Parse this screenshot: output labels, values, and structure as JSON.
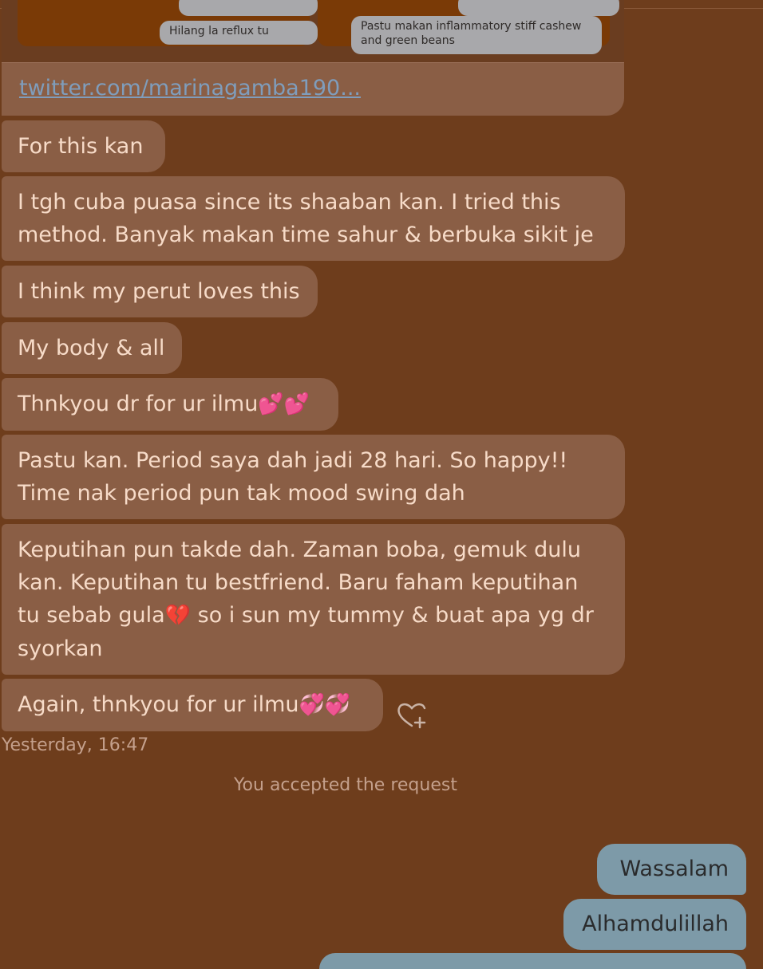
{
  "tweet_preview": {
    "media_left_text": "Hilang la reflux tu",
    "media_right_text": "Pastu makan inflammatory stiff cashew and green beans",
    "link": "twitter.com/marinagamba190..."
  },
  "messages": [
    {
      "lines": [
        "For this kan"
      ]
    },
    {
      "lines": [
        "I tgh cuba puasa since its shaaban kan. I tried this",
        "method. Banyak makan time sahur & berbuka sikit je"
      ]
    },
    {
      "lines": [
        "I think my perut loves this"
      ]
    },
    {
      "lines": [
        "My body & all"
      ]
    },
    {
      "text": "Thnkyou dr for ur ilmu",
      "emoji": "💕💕"
    },
    {
      "lines": [
        "Pastu kan. Period saya dah jadi 28 hari. So happy!!",
        "Time nak period pun tak mood swing dah"
      ]
    },
    {
      "lines": [
        "Keputihan pun takde dah. Zaman boba, gemuk dulu",
        "kan. Keputihan tu bestfriend. Baru faham keputihan"
      ],
      "line3_pre": "tu sebab gula",
      "line3_emoji": "💔",
      "line3_post": " so i sun my tummy & buat apa yg dr",
      "line4": "syorkan"
    },
    {
      "text": "Again, thnkyou for ur ilmu",
      "emoji": "💞💞"
    }
  ],
  "timestamp": "Yesterday, 16:47",
  "system_message": "You accepted the request",
  "outgoing": [
    "Wassalam",
    "Alhamdulillah"
  ],
  "icons": {
    "reaction": "heart-plus-icon"
  },
  "colors": {
    "background": "#6e3d1c",
    "incoming_bubble": "#8a5e45",
    "outgoing_bubble": "#7d9aa8",
    "link": "#7f9dbc"
  }
}
